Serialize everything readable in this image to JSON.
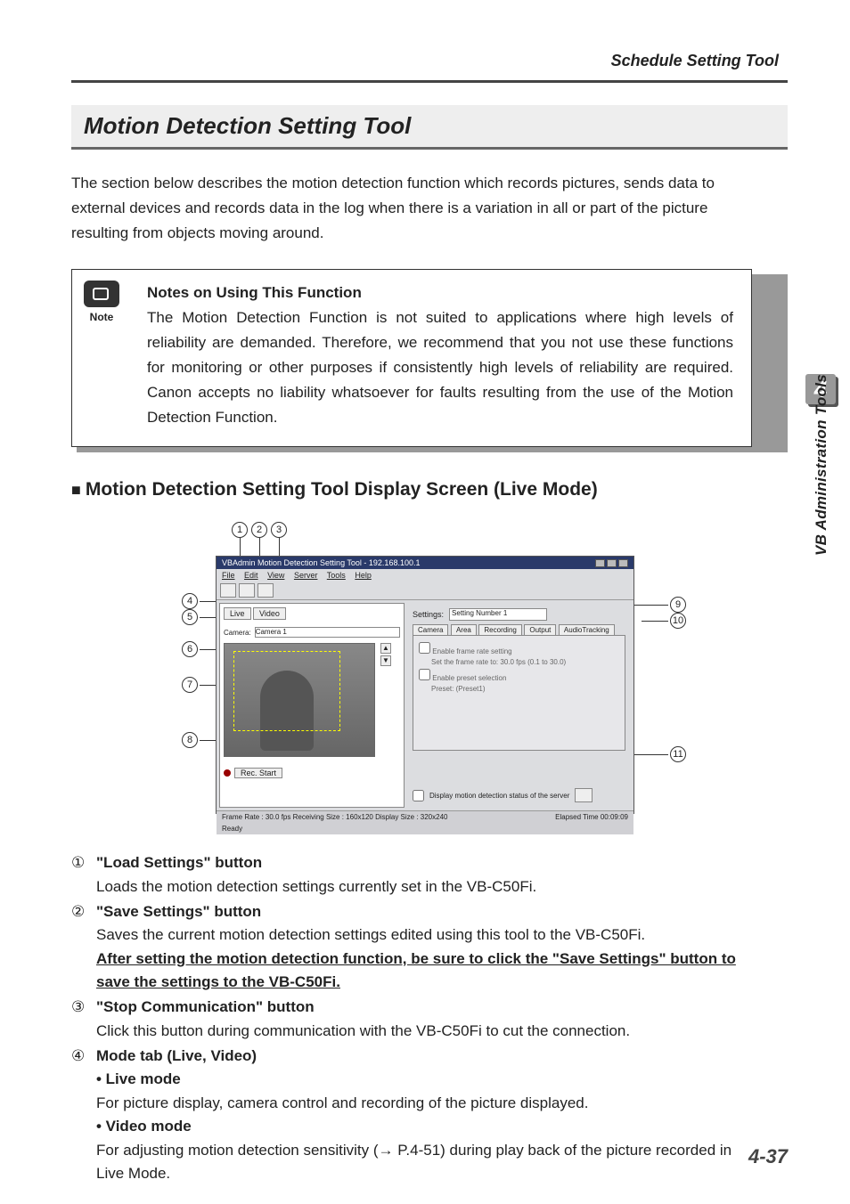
{
  "header": "Schedule Setting Tool",
  "chapter_number": "4",
  "sidebar_text": "VB Administration Tools",
  "title": "Motion Detection Setting Tool",
  "intro": "The section below describes the motion detection function which records pictures, sends data to external devices and records data in the log when there is a variation in all or part of the picture resulting from objects moving around.",
  "note": {
    "icon_label": "Note",
    "title": "Notes on Using This Function",
    "body": "The Motion Detection Function is not suited to applications where high levels of reliability are demanded. Therefore, we recommend that you not use these functions for monitoring or other purposes if consistently high levels of reliability are required. Canon accepts no liability whatsoever for faults resulting from the use of the Motion Detection Function."
  },
  "section_heading": "Motion Detection Setting Tool Display Screen (Live Mode)",
  "screenshot": {
    "window_title": "VBAdmin Motion Detection Setting Tool - 192.168.100.1",
    "menus": [
      "File",
      "Edit",
      "View",
      "Server",
      "Tools",
      "Help"
    ],
    "mode_tabs": [
      "Live",
      "Video"
    ],
    "camera_label": "Camera:",
    "camera_value": "Camera 1",
    "rec_label": "Rec. Start",
    "settings_label": "Settings:",
    "settings_value": "Setting Number 1",
    "panel_tabs": [
      "Camera",
      "Area",
      "Recording",
      "Output",
      "AudioTracking"
    ],
    "panel_chk1": "Enable frame rate setting",
    "panel_field1_label": "Set the frame rate to:",
    "panel_field1_value": "30.0   fps (0.1 to 30.0)",
    "panel_chk2": "Enable preset selection",
    "panel_field2_label": "Preset:",
    "panel_field2_value": "(Preset1)",
    "bottom_chk": "Display motion detection status of the server",
    "status_left": "Frame Rate : 30.0 fps    Receiving Size : 160x120    Display Size : 320x240",
    "status_ready": "Ready",
    "status_right": "Elapsed Time 00:09:09"
  },
  "callouts": {
    "c1": "1",
    "c2": "2",
    "c3": "3",
    "c4": "4",
    "c5": "5",
    "c6": "6",
    "c7": "7",
    "c8": "8",
    "c9": "9",
    "c10": "10",
    "c11": "11"
  },
  "list": {
    "i1": {
      "num": "①",
      "title": "\"Load Settings\" button",
      "text": "Loads the motion detection settings currently set in the VB-C50Fi."
    },
    "i2": {
      "num": "②",
      "title": "\"Save Settings\" button",
      "text": "Saves the current motion detection settings edited using this tool to the VB-C50Fi.",
      "under": "After setting the motion detection function, be sure to click the \"Save Settings\" button to save the settings to the VB-C50Fi."
    },
    "i3": {
      "num": "③",
      "title": "\"Stop Communication\" button",
      "text": "Click this button during communication with the VB-C50Fi to cut the connection."
    },
    "i4": {
      "num": "④",
      "title": "Mode tab (Live, Video)",
      "sub1": "• Live mode",
      "text1": "For picture display, camera control and recording of the picture displayed.",
      "sub2": "• Video mode",
      "text2": "For adjusting motion detection sensitivity (→ P.4-51) during play back of the picture recorded in Live Mode."
    }
  },
  "footer": "4-37"
}
